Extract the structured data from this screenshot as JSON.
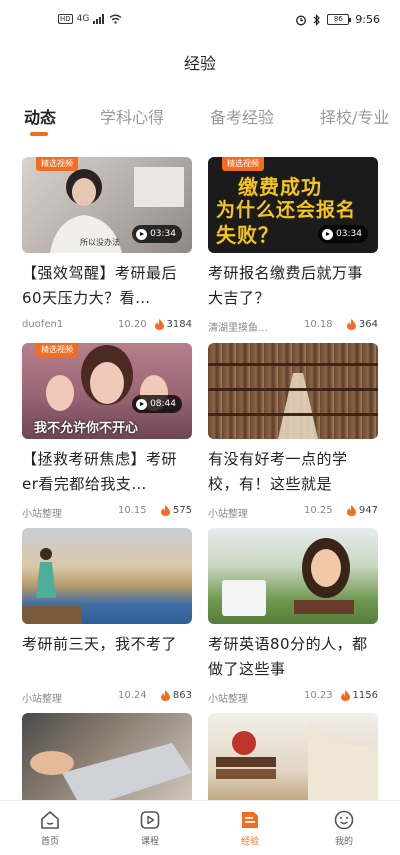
{
  "status_bar": {
    "hd": "HD",
    "network": "4G",
    "battery": "86",
    "time": "9:56"
  },
  "header": {
    "title": "经验"
  },
  "tabs": [
    {
      "label": "动态",
      "active": true
    },
    {
      "label": "学科心得",
      "active": false
    },
    {
      "label": "备考经验",
      "active": false
    },
    {
      "label": "择校/专业",
      "active": false
    }
  ],
  "feed": [
    {
      "badge": "精选视频",
      "duration": "03:34",
      "title": "【强效驾醒】考研最后60天压力大？看…",
      "author": "duofen1",
      "date": "10.20",
      "views": "3184",
      "thumb_caption": "所以没办法"
    },
    {
      "badge": "精选视频",
      "duration": "03:34",
      "title": "考研报名缴费后就万事大吉了？",
      "author": "清湖里摸鱼…",
      "date": "10.18",
      "views": "364",
      "thumb_lines": [
        "缴费成功",
        "为什么还会报名",
        "失败？"
      ]
    },
    {
      "badge": "精选视频",
      "duration": "08:44",
      "title": "【拯救考研焦虑】考研er看完都给我支…",
      "author": "小站整理",
      "date": "10.15",
      "views": "575",
      "thumb_caption": "我不允许你不开心"
    },
    {
      "title": "有没有好考一点的学校，有！这些就是",
      "author": "小站整理",
      "date": "10.25",
      "views": "947"
    },
    {
      "title": "考研前三天，我不考了",
      "author": "小站整理",
      "date": "10.24",
      "views": "863"
    },
    {
      "title": "考研英语80分的人，都做了这些事",
      "author": "小站整理",
      "date": "10.23",
      "views": "1156"
    },
    {
      "title": "",
      "author": "",
      "date": "",
      "views": ""
    },
    {
      "title": "",
      "author": "",
      "date": "",
      "views": ""
    }
  ],
  "bottom_nav": [
    {
      "label": "首页",
      "icon": "home-icon",
      "active": false
    },
    {
      "label": "课程",
      "icon": "play-icon",
      "active": false
    },
    {
      "label": "经验",
      "icon": "notes-icon",
      "active": true
    },
    {
      "label": "我的",
      "icon": "smile-icon",
      "active": false
    }
  ],
  "colors": {
    "accent": "#f26d1f",
    "text": "#222222",
    "muted": "#888888"
  }
}
